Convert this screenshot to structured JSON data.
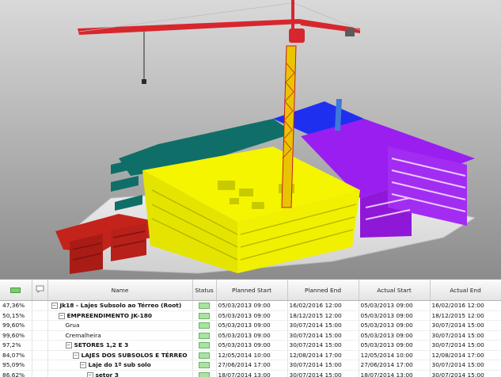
{
  "grid": {
    "columns": {
      "progress_icon": "progress-bar-icon",
      "comment_icon": "comment-icon",
      "name": "Name",
      "status": "Status",
      "planned_start": "Planned Start",
      "planned_end": "Planned End",
      "actual_start": "Actual Start",
      "actual_end": "Actual End"
    },
    "rows": [
      {
        "progress": "47,36%",
        "toggle": "−",
        "name": "Jk18 - Lajes Subsolo ao Térreo (Root)",
        "bold": true,
        "level": 0,
        "planned_start": "05/03/2013 09:00",
        "planned_end": "16/02/2016 12:00",
        "actual_start": "05/03/2013 09:00",
        "actual_end": "16/02/2016 12:00"
      },
      {
        "progress": "50,15%",
        "toggle": "−",
        "name": "EMPREENDIMENTO JK-180",
        "bold": true,
        "level": 1,
        "planned_start": "05/03/2013 09:00",
        "planned_end": "18/12/2015 12:00",
        "actual_start": "05/03/2013 09:00",
        "actual_end": "18/12/2015 12:00"
      },
      {
        "progress": "99,60%",
        "toggle": "",
        "name": "Grua",
        "bold": false,
        "level": 2,
        "planned_start": "05/03/2013 09:00",
        "planned_end": "30/07/2014 15:00",
        "actual_start": "05/03/2013 09:00",
        "actual_end": "30/07/2014 15:00"
      },
      {
        "progress": "99,60%",
        "toggle": "",
        "name": "Cremalheira",
        "bold": false,
        "level": 2,
        "planned_start": "05/03/2013 09:00",
        "planned_end": "30/07/2014 15:00",
        "actual_start": "05/03/2013 09:00",
        "actual_end": "30/07/2014 15:00"
      },
      {
        "progress": "97,2%",
        "toggle": "−",
        "name": "SETORES 1,2 E 3",
        "bold": true,
        "level": 2,
        "planned_start": "05/03/2013 09:00",
        "planned_end": "30/07/2014 15:00",
        "actual_start": "05/03/2013 09:00",
        "actual_end": "30/07/2014 15:00"
      },
      {
        "progress": "84,07%",
        "toggle": "−",
        "name": "LAJES DOS SUBSOLOS E TÉRREO",
        "bold": true,
        "level": 3,
        "planned_start": "12/05/2014 10:00",
        "planned_end": "12/08/2014 17:00",
        "actual_start": "12/05/2014 10:00",
        "actual_end": "12/08/2014 17:00"
      },
      {
        "progress": "95,09%",
        "toggle": "−",
        "name": "Laje do 1º sub solo",
        "bold": true,
        "level": 4,
        "planned_start": "27/06/2014 17:00",
        "planned_end": "30/07/2014 15:00",
        "actual_start": "27/06/2014 17:00",
        "actual_end": "30/07/2014 15:00"
      },
      {
        "progress": "86,62%",
        "toggle": "−",
        "name": "setor 3",
        "bold": true,
        "level": 5,
        "planned_start": "18/07/2014 13:00",
        "planned_end": "30/07/2014 15:00",
        "actual_start": "18/07/2014 13:00",
        "actual_end": "30/07/2014 15:00"
      }
    ]
  },
  "colors": {
    "status_ok": "#a9e3a0",
    "crane": "#d8262e",
    "sector_yellow": "#f5f500",
    "sector_purple": "#9a1ef0",
    "sector_blue": "#1f2ff0",
    "sector_teal": "#0f6f68",
    "sector_red": "#c4231b"
  }
}
